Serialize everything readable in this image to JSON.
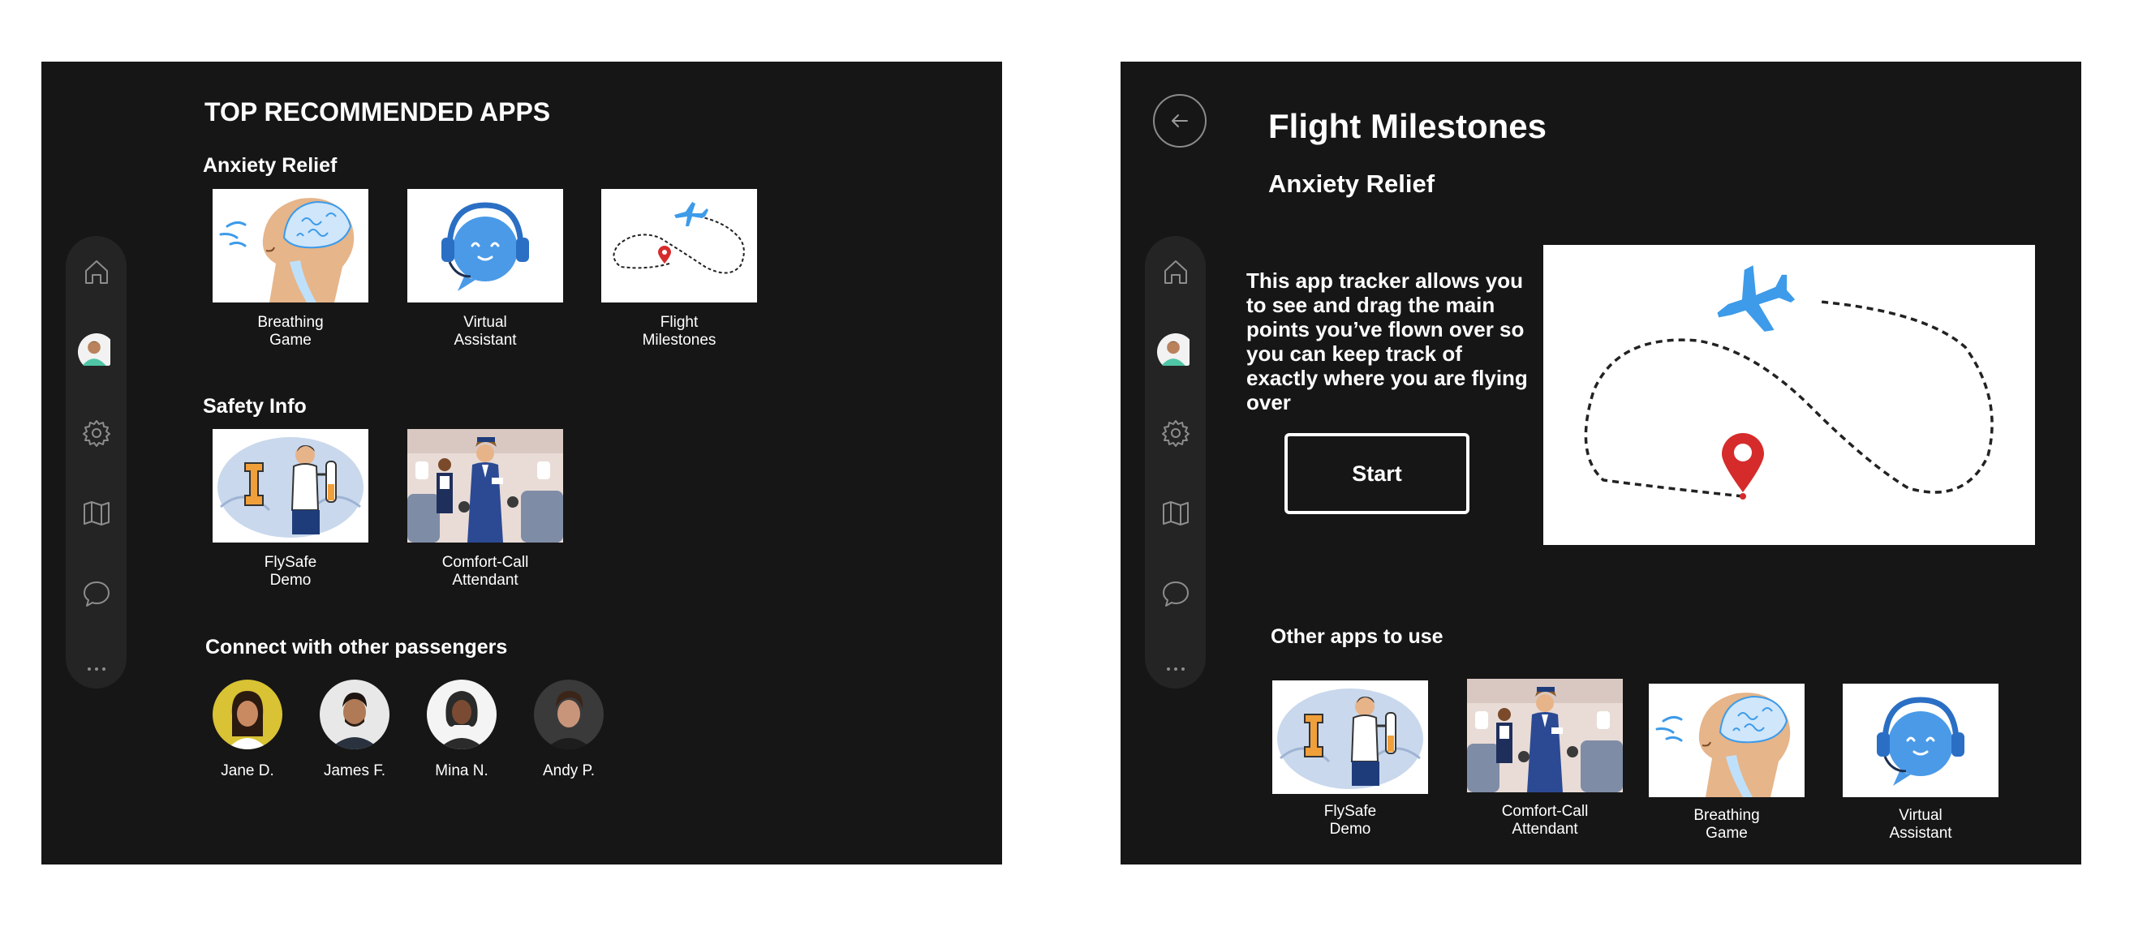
{
  "left_screen": {
    "title": "TOP RECOMMENDED APPS",
    "sections": {
      "anxiety": {
        "title": "Anxiety Relief",
        "apps": [
          {
            "line1": "Breathing",
            "line2": "Game",
            "icon": "breathing-illustration"
          },
          {
            "line1": "Virtual",
            "line2": "Assistant",
            "icon": "robot-headset-illustration"
          },
          {
            "line1": "Flight",
            "line2": "Milestones",
            "icon": "flight-path-illustration"
          }
        ]
      },
      "safety": {
        "title": "Safety Info",
        "apps": [
          {
            "line1": "FlySafe",
            "line2": "Demo",
            "icon": "safety-demo-illustration"
          },
          {
            "line1": "Comfort-Call",
            "line2": "Attendant",
            "icon": "flight-attendant-illustration"
          }
        ]
      },
      "connect": {
        "title": "Connect with other passengers",
        "people": [
          {
            "name": "Jane D."
          },
          {
            "name": "James F."
          },
          {
            "name": "Mina N."
          },
          {
            "name": "Andy P."
          }
        ]
      }
    }
  },
  "right_screen": {
    "title": "Flight Milestones",
    "subtitle": "Anxiety Relief",
    "description": "This app tracker allows you to see and drag the main points you’ve flown over so you can keep track of exactly where you are flying over",
    "start_label": "Start",
    "other_title": "Other apps to use",
    "other_apps": [
      {
        "line1": "FlySafe",
        "line2": "Demo"
      },
      {
        "line1": "Comfort-Call",
        "line2": "Attendant"
      },
      {
        "line1": "Breathing",
        "line2": "Game"
      },
      {
        "line1": "Virtual",
        "line2": "Assistant"
      }
    ]
  },
  "sidebar_icons": [
    "home-icon",
    "avatar",
    "gear-icon",
    "map-icon",
    "chat-icon",
    "more-icon"
  ],
  "colors": {
    "screen_bg": "#161616",
    "sidebar_bg": "#242424",
    "accent_blue": "#3d9be9",
    "pin_red": "#d62b2b"
  }
}
